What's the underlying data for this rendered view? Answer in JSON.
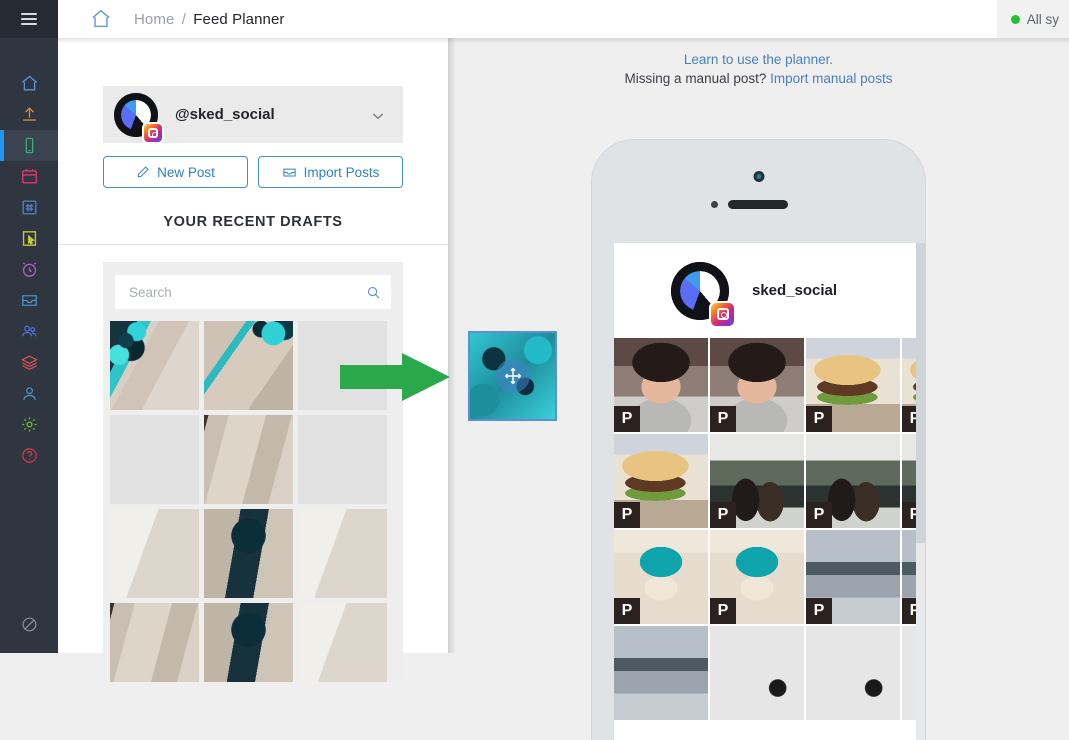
{
  "app": {
    "menu_icon": "hamburger-menu-icon",
    "home_icon": "home-icon"
  },
  "topbar": {
    "breadcrumb_home": "Home",
    "breadcrumb_separator": "/",
    "breadcrumb_current": "Feed Planner",
    "status_text": "All sy",
    "status_color": "#24c231"
  },
  "sidebar": {
    "background": "#2f3640",
    "active_indicator_color": "#2196f3",
    "items": [
      {
        "name": "sidebar-item-home",
        "icon": "home-icon",
        "color": "#5b8fd6",
        "active": false
      },
      {
        "name": "sidebar-item-upload",
        "icon": "upload-icon",
        "color": "#d98c3a",
        "active": false
      },
      {
        "name": "sidebar-item-feed-planner",
        "icon": "mobile-phone-icon",
        "color": "#3cab7a",
        "active": true
      },
      {
        "name": "sidebar-item-calendar",
        "icon": "calendar-icon",
        "color": "#e0396f",
        "active": false
      },
      {
        "name": "sidebar-item-hashtags",
        "icon": "hashtag-icon",
        "color": "#4b82c4",
        "active": false
      },
      {
        "name": "sidebar-item-clicks",
        "icon": "cursor-click-icon",
        "color": "#c4cb3a",
        "active": false
      },
      {
        "name": "sidebar-item-timer",
        "icon": "alarm-clock-icon",
        "color": "#a95ec4",
        "active": false
      },
      {
        "name": "sidebar-item-inbox",
        "icon": "inbox-icon",
        "color": "#4b8fc4",
        "active": false
      },
      {
        "name": "sidebar-item-users",
        "icon": "users-icon",
        "color": "#4b6fd6",
        "active": false
      },
      {
        "name": "sidebar-item-library",
        "icon": "layers-icon",
        "color": "#d9545a",
        "active": false
      },
      {
        "name": "sidebar-item-profile",
        "icon": "user-icon",
        "color": "#4b8fc4",
        "active": false
      },
      {
        "name": "sidebar-item-settings",
        "icon": "gear-icon",
        "color": "#6fc42a",
        "active": false
      },
      {
        "name": "sidebar-item-help",
        "icon": "question-circle-icon",
        "color": "#c4394a",
        "active": false
      }
    ],
    "bottom_item": {
      "name": "sidebar-item-blocked",
      "icon": "no-entry-icon",
      "color": "#8b9199"
    }
  },
  "left_panel": {
    "account": {
      "handle": "@sked_social",
      "platform_badge": "instagram-icon",
      "chevron": "chevron-down-icon"
    },
    "buttons": [
      {
        "name": "new-post-button",
        "label": "New Post",
        "icon": "pencil-icon"
      },
      {
        "name": "import-posts-button",
        "label": "Import Posts",
        "icon": "inbox-icon"
      }
    ],
    "drafts_title": "YOUR RECENT DRAFTS",
    "search": {
      "placeholder": "Search",
      "value": "",
      "icon": "search-icon"
    },
    "draft_cells": [
      {
        "name": "draft-thumb-1",
        "texture": "tex-stone"
      },
      {
        "name": "draft-thumb-2",
        "texture": "tex-stone2"
      },
      {
        "name": "draft-thumb-3",
        "texture": "tex-plain"
      },
      {
        "name": "draft-thumb-4",
        "texture": "tex-plain"
      },
      {
        "name": "draft-thumb-5",
        "texture": "tex-wood"
      },
      {
        "name": "draft-thumb-6",
        "texture": "tex-plain"
      },
      {
        "name": "draft-thumb-7",
        "texture": "tex-bright"
      },
      {
        "name": "draft-thumb-8",
        "texture": "tex-braid"
      },
      {
        "name": "draft-thumb-9",
        "texture": "tex-bright"
      },
      {
        "name": "draft-thumb-10",
        "texture": "tex-wood"
      },
      {
        "name": "draft-thumb-11",
        "texture": "tex-braid"
      },
      {
        "name": "draft-thumb-12",
        "texture": "tex-bright"
      }
    ]
  },
  "planner": {
    "help_link": "Learn to use the planner.",
    "missing_prompt": "Missing a manual post?",
    "import_link": "Import manual posts",
    "link_color": "#4a7fbf"
  },
  "drag": {
    "name": "dragged-draft-thumbnail",
    "texture": "tex-teal",
    "cursor_icon": "move-arrows-icon",
    "border_color": "#5b8fd6"
  },
  "arrow": {
    "name": "instruction-arrow",
    "color": "#2aa84a",
    "direction": "right"
  },
  "phone": {
    "username": "sked_social",
    "platform_badge": "instagram-icon",
    "grid_badge_label": "P",
    "grid_cells": [
      {
        "name": "feed-cell-1",
        "texture": "tex-girl",
        "badge": "P"
      },
      {
        "name": "feed-cell-2",
        "texture": "tex-girl",
        "badge": "P"
      },
      {
        "name": "feed-cell-3",
        "texture": "tex-burger",
        "badge": "P"
      },
      {
        "name": "feed-cell-4",
        "texture": "tex-burger",
        "badge": "P"
      },
      {
        "name": "feed-cell-5",
        "texture": "tex-burger",
        "badge": "P"
      },
      {
        "name": "feed-cell-6",
        "texture": "tex-couple",
        "badge": "P"
      },
      {
        "name": "feed-cell-7",
        "texture": "tex-couple",
        "badge": "P"
      },
      {
        "name": "feed-cell-8",
        "texture": "tex-couple",
        "badge": "P"
      },
      {
        "name": "feed-cell-9",
        "texture": "tex-cupcake",
        "badge": "P"
      },
      {
        "name": "feed-cell-10",
        "texture": "tex-cupcake",
        "badge": "P"
      },
      {
        "name": "feed-cell-11",
        "texture": "tex-lake",
        "badge": "P"
      },
      {
        "name": "feed-cell-12",
        "texture": "tex-lake",
        "badge": "P"
      },
      {
        "name": "feed-cell-13",
        "texture": "tex-lake",
        "badge": ""
      },
      {
        "name": "feed-cell-14",
        "texture": "tex-buds",
        "badge": ""
      },
      {
        "name": "feed-cell-15",
        "texture": "tex-buds",
        "badge": ""
      },
      {
        "name": "feed-cell-16",
        "texture": "tex-buds",
        "badge": ""
      }
    ]
  }
}
